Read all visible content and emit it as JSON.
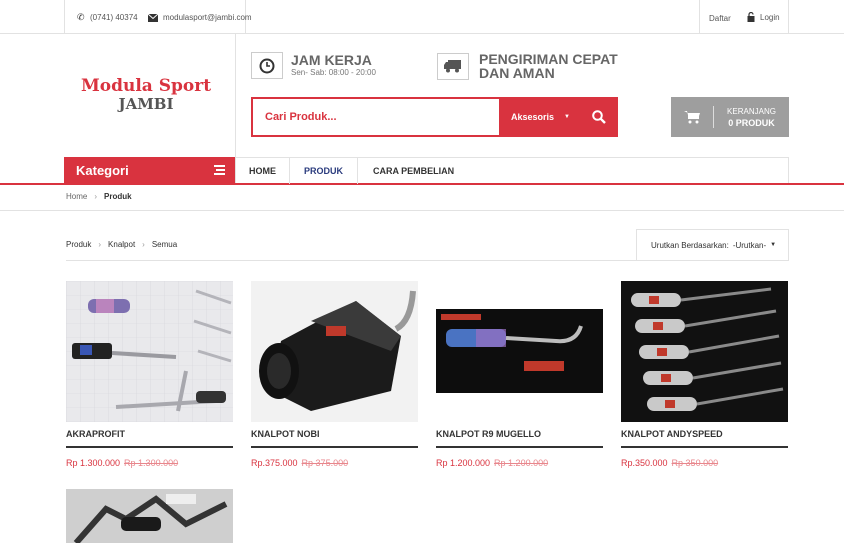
{
  "topbar": {
    "phone": "(0741) 40374",
    "email": "modulasport@jambi.com",
    "register": "Daftar",
    "login": "Login"
  },
  "logo": {
    "line1": "Modula Sport",
    "line2": "JAMBI"
  },
  "info": {
    "hours_title": "JAM KERJA",
    "hours_sub": "Sen- Sab: 08:00 - 20:00",
    "ship_line1": "PENGIRIMAN CEPAT",
    "ship_line2": "DAN AMAN"
  },
  "search": {
    "placeholder": "Cari Produk...",
    "category": "Aksesoris"
  },
  "cart": {
    "label": "KERANJANG",
    "count": "0 PRODUK"
  },
  "nav": {
    "category": "Kategori",
    "items": [
      "HOME",
      "PRODUK",
      "CARA PEMBELIAN"
    ]
  },
  "breadcrumb": {
    "home": "Home",
    "current": "Produk"
  },
  "filter": {
    "crumb1": "Produk",
    "crumb2": "Knalpot",
    "crumb3": "Semua",
    "sort_label": "Urutkan Berdasarkan:",
    "sort_value": "-Urutkan-"
  },
  "products": [
    {
      "name": "AKRAPROFIT",
      "price": "Rp 1.300.000",
      "old_price": "Rp 1.300.000"
    },
    {
      "name": "KNALPOT NOBI",
      "price": "Rp.375.000",
      "old_price": "Rp 375.000"
    },
    {
      "name": "KNALPOT R9 MUGELLO",
      "price": "Rp 1.200.000",
      "old_price": "Rp 1.200.000"
    },
    {
      "name": "KNALPOT ANDYSPEED",
      "price": "Rp.350.000",
      "old_price": "Rp 350.000"
    }
  ],
  "colors": {
    "accent": "#d9333f",
    "dark": "#333333",
    "cart_bg": "#9e9e9e"
  }
}
